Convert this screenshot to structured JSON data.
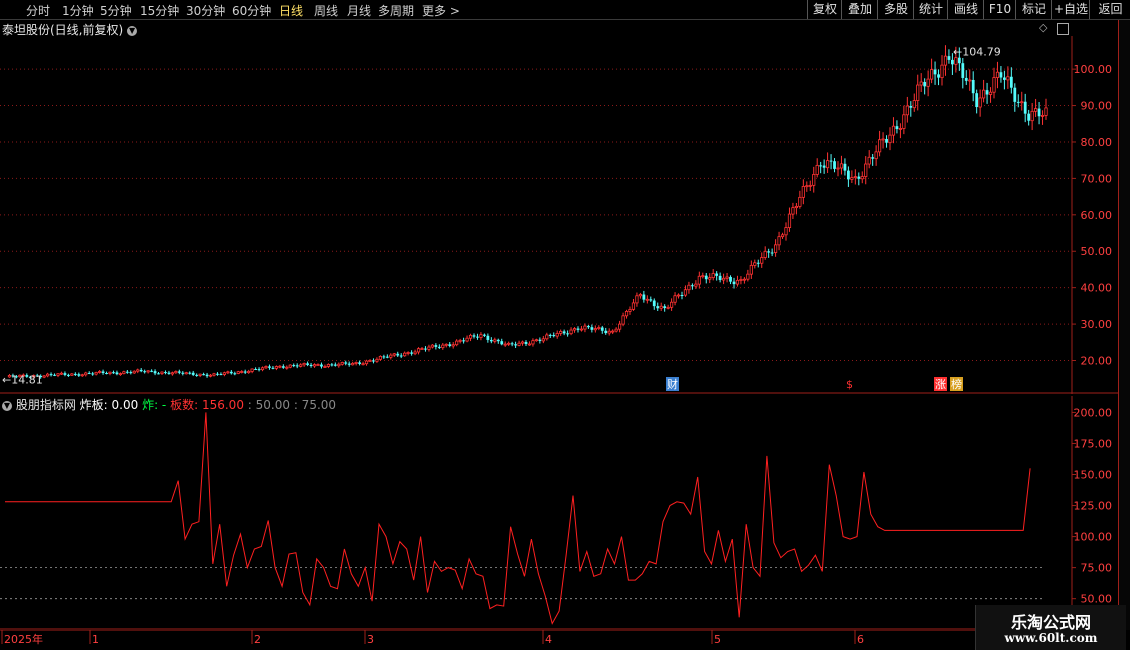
{
  "toolbar": {
    "left_items": [
      "分时",
      "1分钟",
      "5分钟",
      "15分钟",
      "30分钟",
      "60分钟",
      "日线",
      "周线",
      "月线",
      "多周期",
      "更多 >"
    ],
    "active": "日线",
    "right_items": [
      "复权",
      "叠加",
      "多股",
      "统计",
      "画线",
      "F10",
      "标记",
      "+自选",
      "返回"
    ]
  },
  "main_chart": {
    "title": "泰坦股份(日线,前复权)",
    "y_ticks": [
      20,
      30,
      40,
      50,
      60,
      70,
      80,
      90,
      100
    ],
    "y_labels": [
      "20.00",
      "30.00",
      "40.00",
      "50.00",
      "60.00",
      "70.00",
      "80.00",
      "90.00",
      "100.00"
    ],
    "y_range": [
      13,
      108
    ],
    "high_label": "104.79",
    "low_label": "14.81",
    "markers": [
      "财",
      "$",
      "涨",
      "榜"
    ],
    "colors": {
      "up": "#ff3232",
      "down": "#54fcfc",
      "grid": "#8b1a1a",
      "axis": "#a0201a"
    }
  },
  "indicator": {
    "title": "股朋指标网",
    "line_label": "炸板: 0.00",
    "zha_label": "炸: -",
    "ban_label": "板数: 156.00",
    "levels_label": ": 50.00 : 75.00",
    "y_ticks": [
      50,
      75,
      100,
      125,
      150,
      175,
      200
    ],
    "y_labels": [
      "50.00",
      "75.00",
      "100.00",
      "125.00",
      "150.00",
      "175.00",
      "200.00"
    ],
    "y_range": [
      28,
      210
    ],
    "ref_lines": [
      50,
      75
    ]
  },
  "time_axis": {
    "labels": [
      "2025年",
      "1",
      "2",
      "3",
      "4",
      "5",
      "6"
    ]
  },
  "watermark": {
    "line1": "乐淘公式网",
    "line2": "www.60lt.com"
  },
  "chart_data": [
    {
      "type": "candlestick",
      "title": "泰坦股份(日线,前复权)",
      "ylim": [
        13,
        108
      ],
      "key_points": [
        {
          "day": 0,
          "close": 15.5
        },
        {
          "day": 40,
          "close": 17
        },
        {
          "day": 60,
          "close": 16
        },
        {
          "day": 80,
          "close": 18.5
        },
        {
          "day": 100,
          "close": 19
        },
        {
          "day": 115,
          "close": 22
        },
        {
          "day": 130,
          "close": 25
        },
        {
          "day": 137,
          "close": 27
        },
        {
          "day": 145,
          "close": 24
        },
        {
          "day": 155,
          "close": 26
        },
        {
          "day": 165,
          "close": 29
        },
        {
          "day": 175,
          "close": 28
        },
        {
          "day": 183,
          "close": 38
        },
        {
          "day": 190,
          "close": 34
        },
        {
          "day": 200,
          "close": 43
        },
        {
          "day": 212,
          "close": 42
        },
        {
          "day": 222,
          "close": 52
        },
        {
          "day": 235,
          "close": 75
        },
        {
          "day": 245,
          "close": 70
        },
        {
          "day": 255,
          "close": 82
        },
        {
          "day": 265,
          "close": 96
        },
        {
          "day": 272,
          "close": 104
        },
        {
          "day": 280,
          "close": 92
        },
        {
          "day": 287,
          "close": 98
        },
        {
          "day": 295,
          "close": 88
        },
        {
          "day": 300,
          "close": 87
        }
      ]
    },
    {
      "type": "line",
      "name": "炸板",
      "ylim": [
        28,
        210
      ],
      "x": [
        0,
        1,
        2,
        3,
        4,
        5,
        6,
        7,
        8,
        9,
        10,
        11,
        12,
        13,
        14,
        15,
        16,
        17,
        18,
        19,
        20,
        21,
        22,
        23,
        24,
        25,
        26,
        27,
        28,
        29,
        30,
        31,
        32,
        33,
        34,
        35,
        36,
        37,
        38,
        39,
        40,
        41,
        42,
        43,
        44,
        45,
        46,
        47,
        48,
        49,
        50,
        51,
        52,
        53,
        54,
        55,
        56,
        57,
        58,
        59,
        60,
        61,
        62,
        63,
        64,
        65,
        66,
        67,
        68,
        69,
        70,
        71,
        72,
        73,
        74,
        75,
        76,
        77,
        78,
        79,
        80,
        81,
        82,
        83,
        84,
        85,
        86,
        87,
        88,
        89,
        90,
        91,
        92,
        93,
        94,
        95,
        96,
        97,
        98,
        99,
        100,
        101,
        102,
        103,
        104,
        105,
        106,
        107,
        108,
        109,
        110,
        111,
        112,
        113,
        114,
        115,
        116,
        117,
        118,
        119,
        120,
        121,
        122,
        123,
        124,
        125,
        126,
        127,
        128,
        129,
        130,
        131,
        132,
        133,
        134,
        135,
        136,
        137,
        138,
        139,
        140,
        141,
        142,
        143,
        144,
        145,
        146,
        147,
        148,
        149,
        150
      ],
      "values": [
        128,
        128,
        128,
        128,
        128,
        128,
        128,
        128,
        128,
        128,
        128,
        128,
        128,
        128,
        128,
        128,
        128,
        128,
        128,
        128,
        128,
        128,
        128,
        128,
        128,
        145,
        98,
        110,
        112,
        200,
        78,
        110,
        60,
        85,
        102,
        75,
        90,
        92,
        113,
        75,
        60,
        86,
        87,
        55,
        45,
        82,
        75,
        60,
        58,
        90,
        70,
        60,
        75,
        48,
        110,
        100,
        78,
        96,
        90,
        65,
        100,
        55,
        80,
        72,
        75,
        73,
        58,
        82,
        70,
        68,
        42,
        45,
        44,
        108,
        86,
        68,
        98,
        70,
        52,
        30,
        40,
        85,
        133,
        72,
        88,
        68,
        70,
        90,
        78,
        100,
        65,
        65,
        70,
        80,
        78,
        112,
        125,
        128,
        127,
        118,
        148,
        88,
        78,
        105,
        80,
        98,
        35,
        110,
        75,
        68,
        165,
        95,
        83,
        88,
        90,
        72,
        77,
        85,
        72,
        158,
        133,
        100,
        98,
        100,
        152,
        118,
        108,
        105,
        105,
        105,
        105,
        105,
        105,
        105,
        105,
        105,
        105,
        105,
        105,
        105,
        105,
        105,
        105,
        105,
        105,
        105,
        105,
        105,
        155
      ]
    }
  ]
}
